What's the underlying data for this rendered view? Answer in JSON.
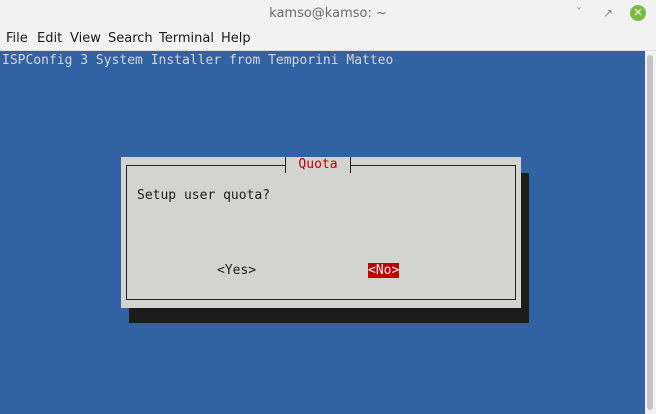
{
  "window": {
    "title": "kamso@kamso: ~",
    "minimize_glyph": "ˇ",
    "maximize_glyph": "↗",
    "close_glyph": "✕"
  },
  "menu": [
    "File",
    "Edit",
    "View",
    "Search",
    "Terminal",
    "Help"
  ],
  "terminal": {
    "header_line": "ISPConfig 3 System Installer from Temporini Matteo",
    "background_color": "#3163a4",
    "text_color": "#d6d6d6"
  },
  "dialog": {
    "title": "Quota",
    "message": "Setup user quota?",
    "yes_label": "<Yes>",
    "no_label": "<No>",
    "selected": "No",
    "accent_color": "#c40000",
    "background_color": "#d3d3cf"
  }
}
